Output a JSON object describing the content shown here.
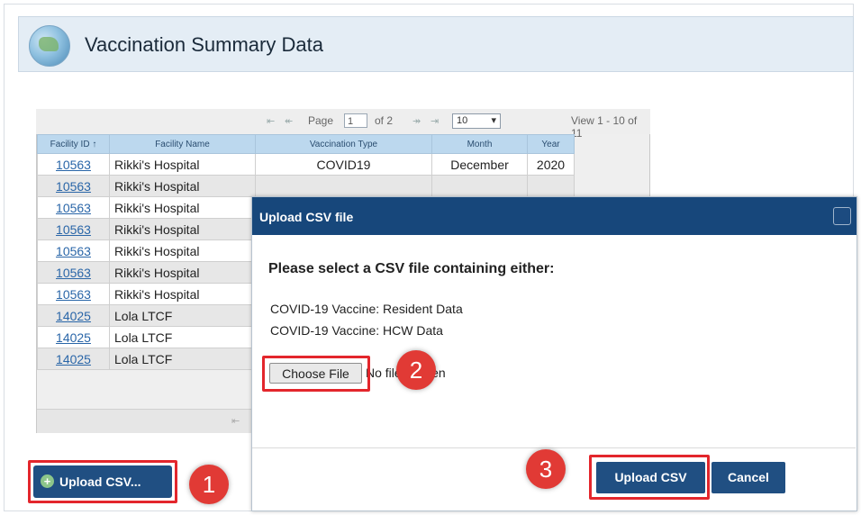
{
  "header": {
    "title": "Vaccination Summary Data",
    "logo_icon": "vaccination-logo-icon"
  },
  "pager": {
    "page_label": "Page",
    "current_page": "1",
    "of_label": "of 2",
    "page_size": "10",
    "view_text": "View 1 - 10 of 11"
  },
  "table": {
    "columns": [
      "Facility ID",
      "Facility Name",
      "Vaccination Type",
      "Month",
      "Year"
    ],
    "sort_indicator": "↑",
    "rows": [
      {
        "facility_id": "10563",
        "facility_name": "Rikki's Hospital",
        "vaccination_type": "COVID19",
        "month": "December",
        "year": "2020"
      },
      {
        "facility_id": "10563",
        "facility_name": "Rikki's Hospital"
      },
      {
        "facility_id": "10563",
        "facility_name": "Rikki's Hospital"
      },
      {
        "facility_id": "10563",
        "facility_name": "Rikki's Hospital"
      },
      {
        "facility_id": "10563",
        "facility_name": "Rikki's Hospital"
      },
      {
        "facility_id": "10563",
        "facility_name": "Rikki's Hospital"
      },
      {
        "facility_id": "10563",
        "facility_name": "Rikki's Hospital"
      },
      {
        "facility_id": "14025",
        "facility_name": "Lola LTCF"
      },
      {
        "facility_id": "14025",
        "facility_name": "Lola LTCF"
      },
      {
        "facility_id": "14025",
        "facility_name": "Lola LTCF"
      }
    ]
  },
  "upload_button": {
    "label": "Upload CSV..."
  },
  "dialog": {
    "title": "Upload CSV file",
    "prompt": "Please select a CSV file containing either:",
    "options": [
      "COVID-19 Vaccine: Resident Data",
      "COVID-19 Vaccine: HCW Data"
    ],
    "choose_file_label": "Choose File",
    "no_file_text": "No file chosen",
    "upload_label": "Upload CSV",
    "cancel_label": "Cancel"
  },
  "steps": [
    "1",
    "2",
    "3"
  ],
  "colors": {
    "primary": "#204f82",
    "dialog_header": "#17477b",
    "highlight": "#e3262c",
    "header_bg": "#e4edf5",
    "column_header_bg": "#bcd8ee",
    "link": "#2a66a8"
  }
}
